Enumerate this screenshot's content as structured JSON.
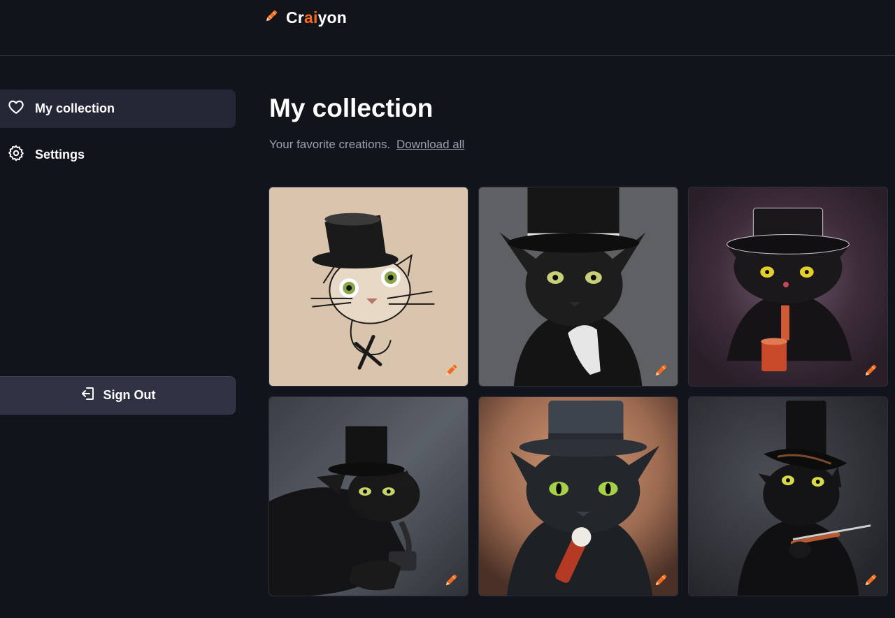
{
  "brand": {
    "name_prefix": "Cr",
    "name_accent": "ai",
    "name_suffix": "yon",
    "icon": "crayon-icon",
    "accent_color": "#f26b1d"
  },
  "sidebar": {
    "items": [
      {
        "label": "My collection",
        "icon": "heart-icon",
        "active": true
      },
      {
        "label": "Settings",
        "icon": "gear-icon",
        "active": false
      }
    ],
    "sign_out": {
      "label": "Sign Out",
      "icon": "sign-out-icon"
    }
  },
  "main": {
    "title": "My collection",
    "subtitle": "Your favorite creations.",
    "download_link": "Download all"
  },
  "gallery": {
    "edit_icon": "crayon-edit-icon",
    "images": [
      {
        "subject": "sketched cat with top hat",
        "background": "#d9c4ae"
      },
      {
        "subject": "black cat in top hat and suit",
        "background": "#5f6063"
      },
      {
        "subject": "black cat with top hat and pipe",
        "background": "#3b2a36"
      },
      {
        "subject": "black cat in top hat with pipe",
        "background": "#4b4f57"
      },
      {
        "subject": "black cat in top hat with pipe",
        "background": "#b88565"
      },
      {
        "subject": "black cat in top hat with cigar holder",
        "background": "#34363c"
      }
    ]
  }
}
